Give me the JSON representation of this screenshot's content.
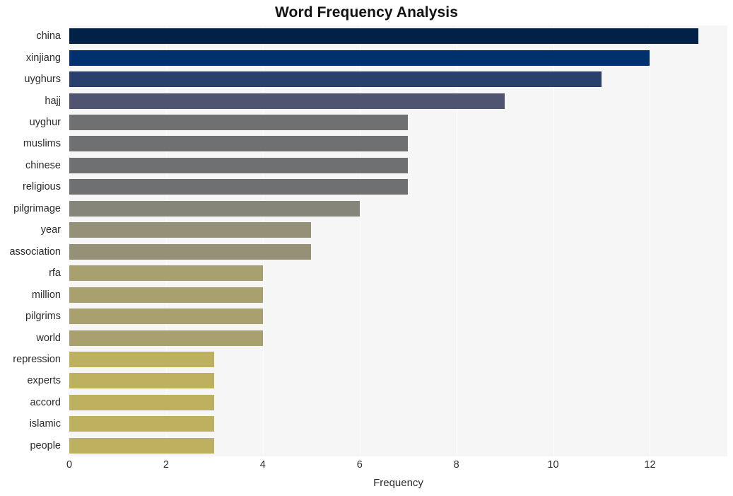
{
  "chart_data": {
    "type": "bar",
    "orientation": "horizontal",
    "title": "Word Frequency Analysis",
    "xlabel": "Frequency",
    "ylabel": "",
    "categories": [
      "china",
      "xinjiang",
      "uyghurs",
      "hajj",
      "uyghur",
      "muslims",
      "chinese",
      "religious",
      "pilgrimage",
      "year",
      "association",
      "rfa",
      "million",
      "pilgrims",
      "world",
      "repression",
      "experts",
      "accord",
      "islamic",
      "people"
    ],
    "values": [
      13,
      12,
      11,
      9,
      7,
      7,
      7,
      7,
      6,
      5,
      5,
      4,
      4,
      4,
      4,
      3,
      3,
      3,
      3,
      3
    ],
    "bar_colors": [
      "#012147",
      "#00316e",
      "#293f6c",
      "#4f5570",
      "#6f7072",
      "#6f7072",
      "#6f7072",
      "#6f7072",
      "#85857a",
      "#959176",
      "#959176",
      "#a9a070",
      "#a9a070",
      "#a9a070",
      "#a9a070",
      "#bdb05f",
      "#bdb05f",
      "#bdb05f",
      "#bdb05f",
      "#bdb05f"
    ],
    "xlim": [
      0,
      13.6
    ],
    "xticks": [
      0,
      2,
      4,
      6,
      8,
      10,
      12
    ],
    "xticklabels": [
      "0",
      "2",
      "4",
      "6",
      "8",
      "10",
      "12"
    ],
    "grid": true,
    "grid_color": "#fdfdfd",
    "plot_background": "#f6f6f6",
    "figure_background": "#ffffff",
    "legend": null,
    "legend_position": "none"
  }
}
